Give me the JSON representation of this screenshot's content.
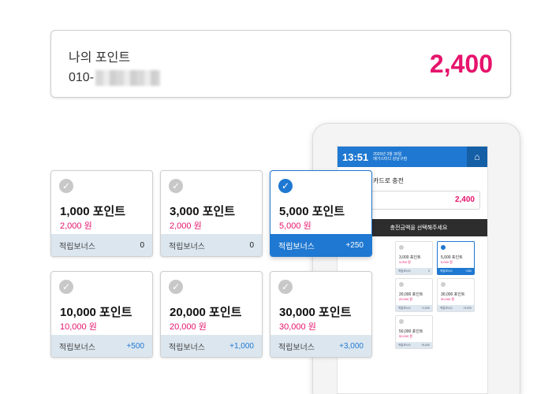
{
  "header": {
    "title": "나의 포인트",
    "phone_prefix": "010-",
    "points": "2,400"
  },
  "options": [
    {
      "title": "1,000 포인트",
      "won": "2,000 원",
      "bonus_label": "적립보너스",
      "bonus_value": "0",
      "selected": false
    },
    {
      "title": "3,000 포인트",
      "won": "2,000 원",
      "bonus_label": "적립보너스",
      "bonus_value": "0",
      "selected": false
    },
    {
      "title": "5,000 포인트",
      "won": "5,000 원",
      "bonus_label": "적립보너스",
      "bonus_value": "+250",
      "selected": true
    },
    {
      "title": "10,000 포인트",
      "won": "10,000 원",
      "bonus_label": "적립보너스",
      "bonus_value": "+500",
      "selected": false
    },
    {
      "title": "20,000 포인트",
      "won": "20,000 원",
      "bonus_label": "적립보너스",
      "bonus_value": "+1,000",
      "selected": false
    },
    {
      "title": "30,000 포인트",
      "won": "30,000 원",
      "bonus_label": "적립보너스",
      "bonus_value": "+3,000",
      "selected": false
    }
  ],
  "tablet": {
    "time": "13:51",
    "date": "2020년 3월 30일",
    "subtitle": "메가스터디 강남구점",
    "home_icon": "home-icon",
    "screen_title": "카드로 충전",
    "points": "2,400",
    "banner": "충전금액을 선택해주세요",
    "mini_cards": [
      {
        "title": "3,000 포인트",
        "won": "3,000 원",
        "bonus": "0",
        "selected": false
      },
      {
        "title": "5,000 포인트",
        "won": "5,000 원",
        "bonus": "+250",
        "selected": true
      },
      {
        "title": "20,000 포인트",
        "won": "20,000 원",
        "bonus": "+1,000",
        "selected": false
      },
      {
        "title": "30,000 포인트",
        "won": "30,000 원",
        "bonus": "+3,000",
        "selected": false
      },
      {
        "title": "50,000 포인트",
        "won": "50,000 원",
        "bonus": "+5,000",
        "selected": false
      }
    ]
  },
  "colors": {
    "accent_blue": "#1f78d1",
    "price_pink": "#e6136c",
    "bonus_bg": "#dbe6ef"
  }
}
